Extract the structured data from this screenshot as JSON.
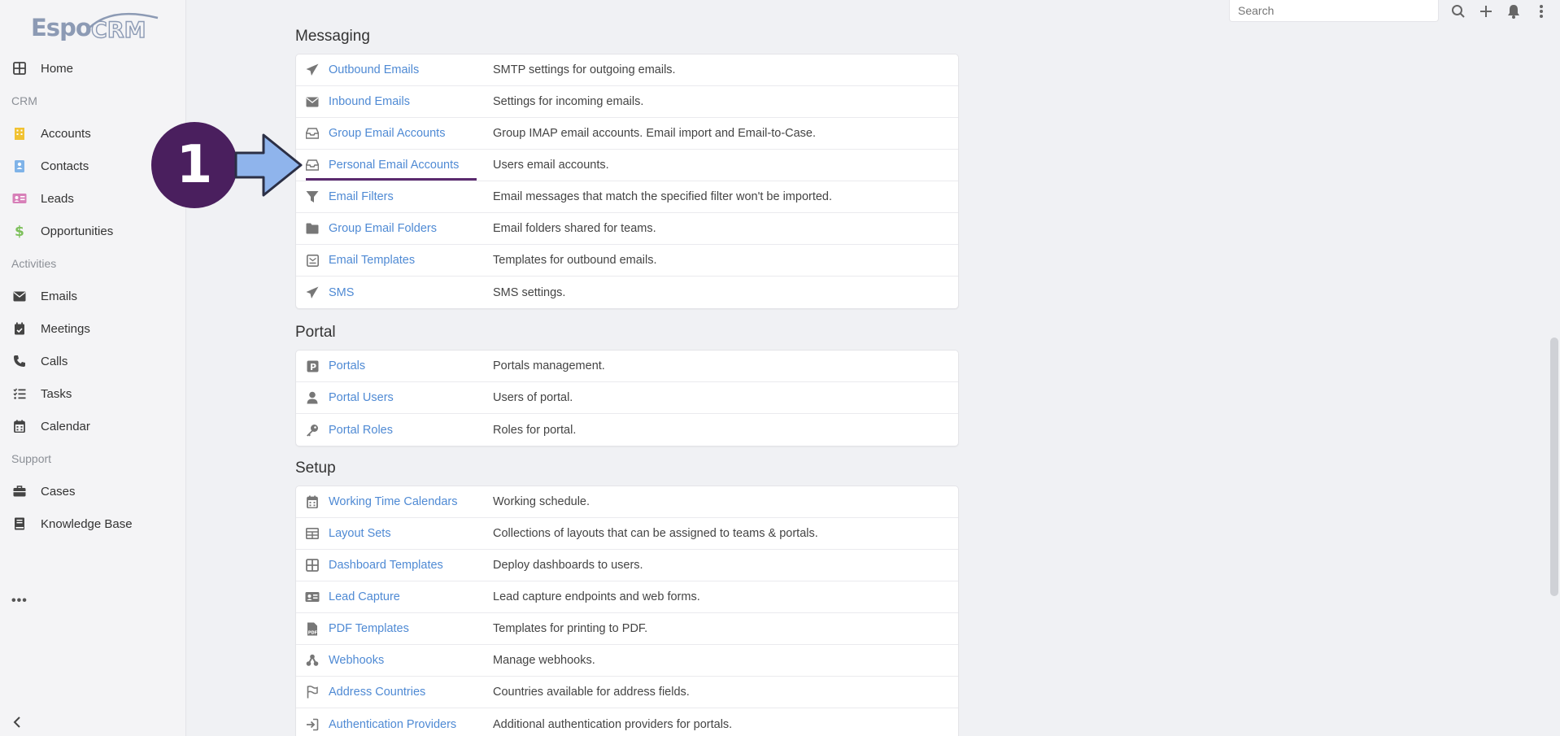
{
  "app": {
    "logo_text": "EspoCRM"
  },
  "search": {
    "placeholder": "Search"
  },
  "sidebar": {
    "items": [
      {
        "label": "Home",
        "icon": "grid-icon",
        "color": "#444"
      },
      {
        "group": "CRM"
      },
      {
        "label": "Accounts",
        "icon": "building-icon",
        "color": "#f1c232"
      },
      {
        "label": "Contacts",
        "icon": "contact-card-icon",
        "color": "#7fb3e8"
      },
      {
        "label": "Leads",
        "icon": "id-card-icon",
        "color": "#d77fb8"
      },
      {
        "label": "Opportunities",
        "icon": "dollar-icon",
        "color": "#7cbf5a"
      },
      {
        "group": "Activities"
      },
      {
        "label": "Emails",
        "icon": "envelope-icon",
        "color": "#444"
      },
      {
        "label": "Meetings",
        "icon": "calendar-check-icon",
        "color": "#444"
      },
      {
        "label": "Calls",
        "icon": "phone-icon",
        "color": "#444"
      },
      {
        "label": "Tasks",
        "icon": "tasks-icon",
        "color": "#444"
      },
      {
        "label": "Calendar",
        "icon": "calendar-icon",
        "color": "#444"
      },
      {
        "group": "Support"
      },
      {
        "label": "Cases",
        "icon": "briefcase-icon",
        "color": "#444"
      },
      {
        "label": "Knowledge Base",
        "icon": "book-icon",
        "color": "#444"
      }
    ],
    "more_label": "•••"
  },
  "annotation": {
    "number": "1",
    "badge_color": "#4a1f5e",
    "arrow_color": "#8fb4ec"
  },
  "sections": [
    {
      "title": "Messaging",
      "rows": [
        {
          "label": "Outbound Emails",
          "desc": "SMTP settings for outgoing emails.",
          "icon": "paper-plane-icon"
        },
        {
          "label": "Inbound Emails",
          "desc": "Settings for incoming emails.",
          "icon": "envelope-icon"
        },
        {
          "label": "Group Email Accounts",
          "desc": "Group IMAP email accounts. Email import and Email-to-Case.",
          "icon": "inbox-icon"
        },
        {
          "label": "Personal Email Accounts",
          "desc": "Users email accounts.",
          "icon": "inbox-icon"
        },
        {
          "label": "Email Filters",
          "desc": "Email messages that match the specified filter won't be imported.",
          "icon": "filter-icon"
        },
        {
          "label": "Group Email Folders",
          "desc": "Email folders shared for teams.",
          "icon": "folder-icon"
        },
        {
          "label": "Email Templates",
          "desc": "Templates for outbound emails.",
          "icon": "envelope-square-icon"
        },
        {
          "label": "SMS",
          "desc": "SMS settings.",
          "icon": "paper-plane-icon"
        }
      ]
    },
    {
      "title": "Portal",
      "rows": [
        {
          "label": "Portals",
          "desc": "Portals management.",
          "icon": "parking-icon"
        },
        {
          "label": "Portal Users",
          "desc": "Users of portal.",
          "icon": "user-icon"
        },
        {
          "label": "Portal Roles",
          "desc": "Roles for portal.",
          "icon": "key-icon"
        }
      ]
    },
    {
      "title": "Setup",
      "rows": [
        {
          "label": "Working Time Calendars",
          "desc": "Working schedule.",
          "icon": "calendar-icon"
        },
        {
          "label": "Layout Sets",
          "desc": "Collections of layouts that can be assigned to teams & portals.",
          "icon": "table-icon"
        },
        {
          "label": "Dashboard Templates",
          "desc": "Deploy dashboards to users.",
          "icon": "grid-icon"
        },
        {
          "label": "Lead Capture",
          "desc": "Lead capture endpoints and web forms.",
          "icon": "id-card-icon"
        },
        {
          "label": "PDF Templates",
          "desc": "Templates for printing to PDF.",
          "icon": "pdf-icon"
        },
        {
          "label": "Webhooks",
          "desc": "Manage webhooks.",
          "icon": "webhook-icon"
        },
        {
          "label": "Address Countries",
          "desc": "Countries available for address fields.",
          "icon": "flag-icon"
        },
        {
          "label": "Authentication Providers",
          "desc": "Additional authentication providers for portals.",
          "icon": "sign-in-icon"
        }
      ]
    }
  ]
}
